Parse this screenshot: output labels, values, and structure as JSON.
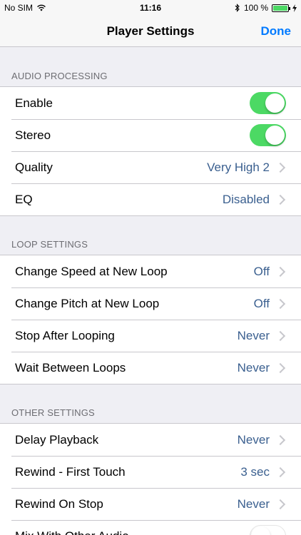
{
  "status_bar": {
    "carrier": "No SIM",
    "time": "11:16",
    "battery": "100 %",
    "battery_level": 1.0
  },
  "navbar": {
    "title": "Player Settings",
    "done_label": "Done"
  },
  "audio_processing": {
    "header": "AUDIO PROCESSING",
    "enable_label": "Enable",
    "enable_on": true,
    "stereo_label": "Stereo",
    "stereo_on": true,
    "quality_label": "Quality",
    "quality_value": "Very High 2",
    "eq_label": "EQ",
    "eq_value": "Disabled"
  },
  "loop_settings": {
    "header": "LOOP SETTINGS",
    "speed_label": "Change Speed at New Loop",
    "speed_value": "Off",
    "pitch_label": "Change Pitch at New Loop",
    "pitch_value": "Off",
    "stop_label": "Stop After Looping",
    "stop_value": "Never",
    "wait_label": "Wait Between Loops",
    "wait_value": "Never"
  },
  "other_settings": {
    "header": "OTHER SETTINGS",
    "delay_label": "Delay Playback",
    "delay_value": "Never",
    "rewind_first_label": "Rewind - First Touch",
    "rewind_first_value": "3 sec",
    "rewind_stop_label": "Rewind On Stop",
    "rewind_stop_value": "Never",
    "mix_label": "Mix With Other Audio",
    "mix_on": false
  },
  "colors": {
    "accent": "#007aff",
    "toggle_on": "#4cd964",
    "value_text": "#3a5f8f"
  }
}
